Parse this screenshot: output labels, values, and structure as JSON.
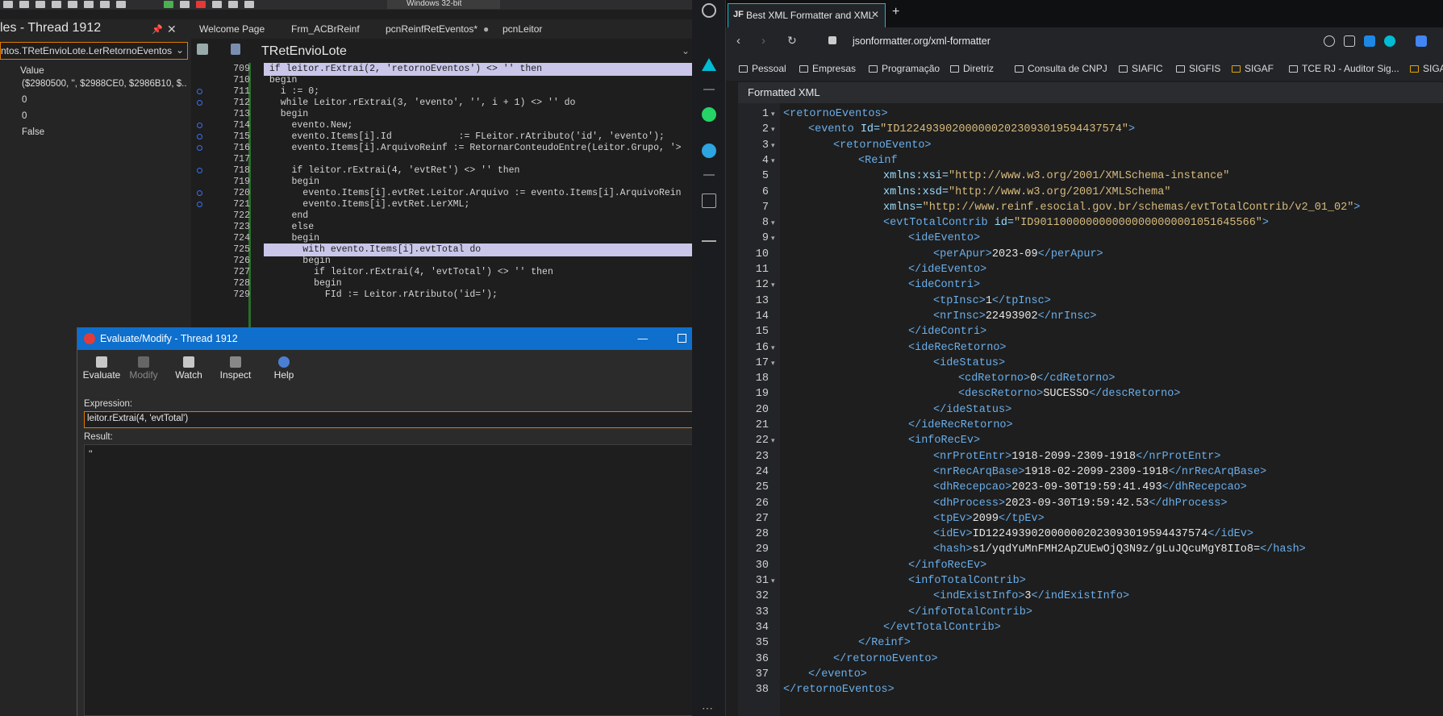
{
  "ide": {
    "platform": "Windows 32-bit",
    "watch_title": "les - Thread 1912",
    "watch_combo": "ntos.TRetEnvioLote.LerRetornoEventos",
    "watch_value_header": "Value",
    "watch_values": [
      "($2980500, '', $2988CE0, $2986B10, $...",
      "0",
      "0",
      "False"
    ],
    "tabs": [
      "Welcome Page",
      "Frm_ACBrReinf",
      "pcnReinfRetEventos*",
      "pcnLeitor"
    ],
    "class_name": "TRetEnvioLote",
    "code": [
      {
        "n": "709",
        "t": "if leitor.rExtrai(2, 'retornoEventos') <> '' then"
      },
      {
        "n": "710",
        "t": "begin"
      },
      {
        "n": "711",
        "t": "  i := 0;"
      },
      {
        "n": "712",
        "t": "  while Leitor.rExtrai(3, 'evento', '', i + 1) <> '' do"
      },
      {
        "n": "713",
        "t": "  begin"
      },
      {
        "n": "714",
        "t": "    evento.New;"
      },
      {
        "n": "715",
        "t": "    evento.Items[i].Id            := FLeitor.rAtributo('id', 'evento');"
      },
      {
        "n": "716",
        "t": "    evento.Items[i].ArquivoReinf := RetornarConteudoEntre(Leitor.Grupo, '>"
      },
      {
        "n": "717",
        "t": ""
      },
      {
        "n": "718",
        "t": "    if leitor.rExtrai(4, 'evtRet') <> '' then"
      },
      {
        "n": "719",
        "t": "    begin"
      },
      {
        "n": "720",
        "t": "      evento.Items[i].evtRet.Leitor.Arquivo := evento.Items[i].ArquivoRein"
      },
      {
        "n": "721",
        "t": "      evento.Items[i].evtRet.LerXML;"
      },
      {
        "n": "722",
        "t": "    end"
      },
      {
        "n": "723",
        "t": "    else"
      },
      {
        "n": "724",
        "t": "    begin"
      },
      {
        "n": "725",
        "t": "      with evento.Items[i].evtTotal do"
      },
      {
        "n": "726",
        "t": "      begin"
      },
      {
        "n": "727",
        "t": "        if leitor.rExtrai(4, 'evtTotal') <> '' then"
      },
      {
        "n": "728",
        "t": "        begin"
      },
      {
        "n": "729",
        "t": "          FId := Leitor.rAtributo('id=');"
      }
    ]
  },
  "eval": {
    "title": "Evaluate/Modify - Thread 1912",
    "buttons": [
      "Evaluate",
      "Modify",
      "Watch",
      "Inspect",
      "Help"
    ],
    "expression_label": "Expression:",
    "expression": "leitor.rExtrai(4, 'evtTotal')",
    "result_label": "Result:",
    "result": "''"
  },
  "browser": {
    "tab_favicon": "JF",
    "tab_title": "Best XML Formatter and XML",
    "url": "jsonformatter.org/xml-formatter",
    "bookmarks": [
      "Pessoal",
      "Empresas",
      "Programação",
      "Diretriz",
      "Consulta de CNPJ",
      "SIAFIC",
      "SIGFIS",
      "SIGAF",
      "TCE RJ - Auditor Sig...",
      "SIGA"
    ],
    "panel_title": "Formatted XML",
    "xml": [
      {
        "n": "1",
        "i": 0,
        "f": true,
        "p": [
          [
            "tg",
            "<retornoEventos>"
          ]
        ]
      },
      {
        "n": "2",
        "i": 1,
        "f": true,
        "p": [
          [
            "tg",
            "<evento "
          ],
          [
            "at",
            "Id="
          ],
          [
            "av",
            "\"ID1224939020000002023093019594437574\""
          ],
          [
            "tg",
            ">"
          ]
        ]
      },
      {
        "n": "3",
        "i": 2,
        "f": true,
        "p": [
          [
            "tg",
            "<retornoEvento>"
          ]
        ]
      },
      {
        "n": "4",
        "i": 3,
        "f": true,
        "p": [
          [
            "tg",
            "<Reinf"
          ]
        ]
      },
      {
        "n": "5",
        "i": 4,
        "f": false,
        "p": [
          [
            "at",
            "xmlns:xsi="
          ],
          [
            "av",
            "\"http://www.w3.org/2001/XMLSchema-instance\""
          ]
        ]
      },
      {
        "n": "6",
        "i": 4,
        "f": false,
        "p": [
          [
            "at",
            "xmlns:xsd="
          ],
          [
            "av",
            "\"http://www.w3.org/2001/XMLSchema\""
          ]
        ]
      },
      {
        "n": "7",
        "i": 4,
        "f": false,
        "p": [
          [
            "at",
            "xmlns="
          ],
          [
            "av",
            "\"http://www.reinf.esocial.gov.br/schemas/evtTotalContrib/v2_01_02\""
          ],
          [
            "tg",
            ">"
          ]
        ]
      },
      {
        "n": "8",
        "i": 4,
        "f": true,
        "p": [
          [
            "tg",
            "<evtTotalContrib "
          ],
          [
            "at",
            "id="
          ],
          [
            "av",
            "\"ID9011000000000000000000001051645566\""
          ],
          [
            "tg",
            ">"
          ]
        ]
      },
      {
        "n": "9",
        "i": 5,
        "f": true,
        "p": [
          [
            "tg",
            "<ideEvento>"
          ]
        ]
      },
      {
        "n": "10",
        "i": 6,
        "f": false,
        "p": [
          [
            "tg",
            "<perApur>"
          ],
          [
            "tx",
            "2023-09"
          ],
          [
            "tg",
            "</perApur>"
          ]
        ]
      },
      {
        "n": "11",
        "i": 5,
        "f": false,
        "p": [
          [
            "tg",
            "</ideEvento>"
          ]
        ]
      },
      {
        "n": "12",
        "i": 5,
        "f": true,
        "p": [
          [
            "tg",
            "<ideContri>"
          ]
        ]
      },
      {
        "n": "13",
        "i": 6,
        "f": false,
        "p": [
          [
            "tg",
            "<tpInsc>"
          ],
          [
            "tx",
            "1"
          ],
          [
            "tg",
            "</tpInsc>"
          ]
        ]
      },
      {
        "n": "14",
        "i": 6,
        "f": false,
        "p": [
          [
            "tg",
            "<nrInsc>"
          ],
          [
            "tx",
            "22493902"
          ],
          [
            "tg",
            "</nrInsc>"
          ]
        ]
      },
      {
        "n": "15",
        "i": 5,
        "f": false,
        "p": [
          [
            "tg",
            "</ideContri>"
          ]
        ]
      },
      {
        "n": "16",
        "i": 5,
        "f": true,
        "p": [
          [
            "tg",
            "<ideRecRetorno>"
          ]
        ]
      },
      {
        "n": "17",
        "i": 6,
        "f": true,
        "p": [
          [
            "tg",
            "<ideStatus>"
          ]
        ]
      },
      {
        "n": "18",
        "i": 7,
        "f": false,
        "p": [
          [
            "tg",
            "<cdRetorno>"
          ],
          [
            "tx",
            "0"
          ],
          [
            "tg",
            "</cdRetorno>"
          ]
        ]
      },
      {
        "n": "19",
        "i": 7,
        "f": false,
        "p": [
          [
            "tg",
            "<descRetorno>"
          ],
          [
            "tx",
            "SUCESSO"
          ],
          [
            "tg",
            "</descRetorno>"
          ]
        ]
      },
      {
        "n": "20",
        "i": 6,
        "f": false,
        "p": [
          [
            "tg",
            "</ideStatus>"
          ]
        ]
      },
      {
        "n": "21",
        "i": 5,
        "f": false,
        "p": [
          [
            "tg",
            "</ideRecRetorno>"
          ]
        ]
      },
      {
        "n": "22",
        "i": 5,
        "f": true,
        "p": [
          [
            "tg",
            "<infoRecEv>"
          ]
        ]
      },
      {
        "n": "23",
        "i": 6,
        "f": false,
        "p": [
          [
            "tg",
            "<nrProtEntr>"
          ],
          [
            "tx",
            "1918-2099-2309-1918"
          ],
          [
            "tg",
            "</nrProtEntr>"
          ]
        ]
      },
      {
        "n": "24",
        "i": 6,
        "f": false,
        "p": [
          [
            "tg",
            "<nrRecArqBase>"
          ],
          [
            "tx",
            "1918-02-2099-2309-1918"
          ],
          [
            "tg",
            "</nrRecArqBase>"
          ]
        ]
      },
      {
        "n": "25",
        "i": 6,
        "f": false,
        "p": [
          [
            "tg",
            "<dhRecepcao>"
          ],
          [
            "tx",
            "2023-09-30T19:59:41.493"
          ],
          [
            "tg",
            "</dhRecepcao>"
          ]
        ]
      },
      {
        "n": "26",
        "i": 6,
        "f": false,
        "p": [
          [
            "tg",
            "<dhProcess>"
          ],
          [
            "tx",
            "2023-09-30T19:59:42.53"
          ],
          [
            "tg",
            "</dhProcess>"
          ]
        ]
      },
      {
        "n": "27",
        "i": 6,
        "f": false,
        "p": [
          [
            "tg",
            "<tpEv>"
          ],
          [
            "tx",
            "2099"
          ],
          [
            "tg",
            "</tpEv>"
          ]
        ]
      },
      {
        "n": "28",
        "i": 6,
        "f": false,
        "p": [
          [
            "tg",
            "<idEv>"
          ],
          [
            "tx",
            "ID1224939020000002023093019594437574"
          ],
          [
            "tg",
            "</idEv>"
          ]
        ]
      },
      {
        "n": "29",
        "i": 6,
        "f": false,
        "p": [
          [
            "tg",
            "<hash>"
          ],
          [
            "tx",
            "s1/yqdYuMnFMH2ApZUEwOjQ3N9z/gLuJQcuMgY8IIo8="
          ],
          [
            "tg",
            "</hash>"
          ]
        ]
      },
      {
        "n": "30",
        "i": 5,
        "f": false,
        "p": [
          [
            "tg",
            "</infoRecEv>"
          ]
        ]
      },
      {
        "n": "31",
        "i": 5,
        "f": true,
        "p": [
          [
            "tg",
            "<infoTotalContrib>"
          ]
        ]
      },
      {
        "n": "32",
        "i": 6,
        "f": false,
        "p": [
          [
            "tg",
            "<indExistInfo>"
          ],
          [
            "tx",
            "3"
          ],
          [
            "tg",
            "</indExistInfo>"
          ]
        ]
      },
      {
        "n": "33",
        "i": 5,
        "f": false,
        "p": [
          [
            "tg",
            "</infoTotalContrib>"
          ]
        ]
      },
      {
        "n": "34",
        "i": 4,
        "f": false,
        "p": [
          [
            "tg",
            "</evtTotalContrib>"
          ]
        ]
      },
      {
        "n": "35",
        "i": 3,
        "f": false,
        "p": [
          [
            "tg",
            "</Reinf>"
          ]
        ]
      },
      {
        "n": "36",
        "i": 2,
        "f": false,
        "p": [
          [
            "tg",
            "</retornoEvento>"
          ]
        ]
      },
      {
        "n": "37",
        "i": 1,
        "f": false,
        "p": [
          [
            "tg",
            "</evento>"
          ]
        ]
      },
      {
        "n": "38",
        "i": 0,
        "f": false,
        "p": [
          [
            "tg",
            "</retornoEventos>"
          ]
        ]
      }
    ]
  },
  "colors": {
    "accent": "#0e6fcd",
    "highlight": "#c9c6ea",
    "focus_border": "#e07b00",
    "tab_border": "#00c4d8"
  }
}
